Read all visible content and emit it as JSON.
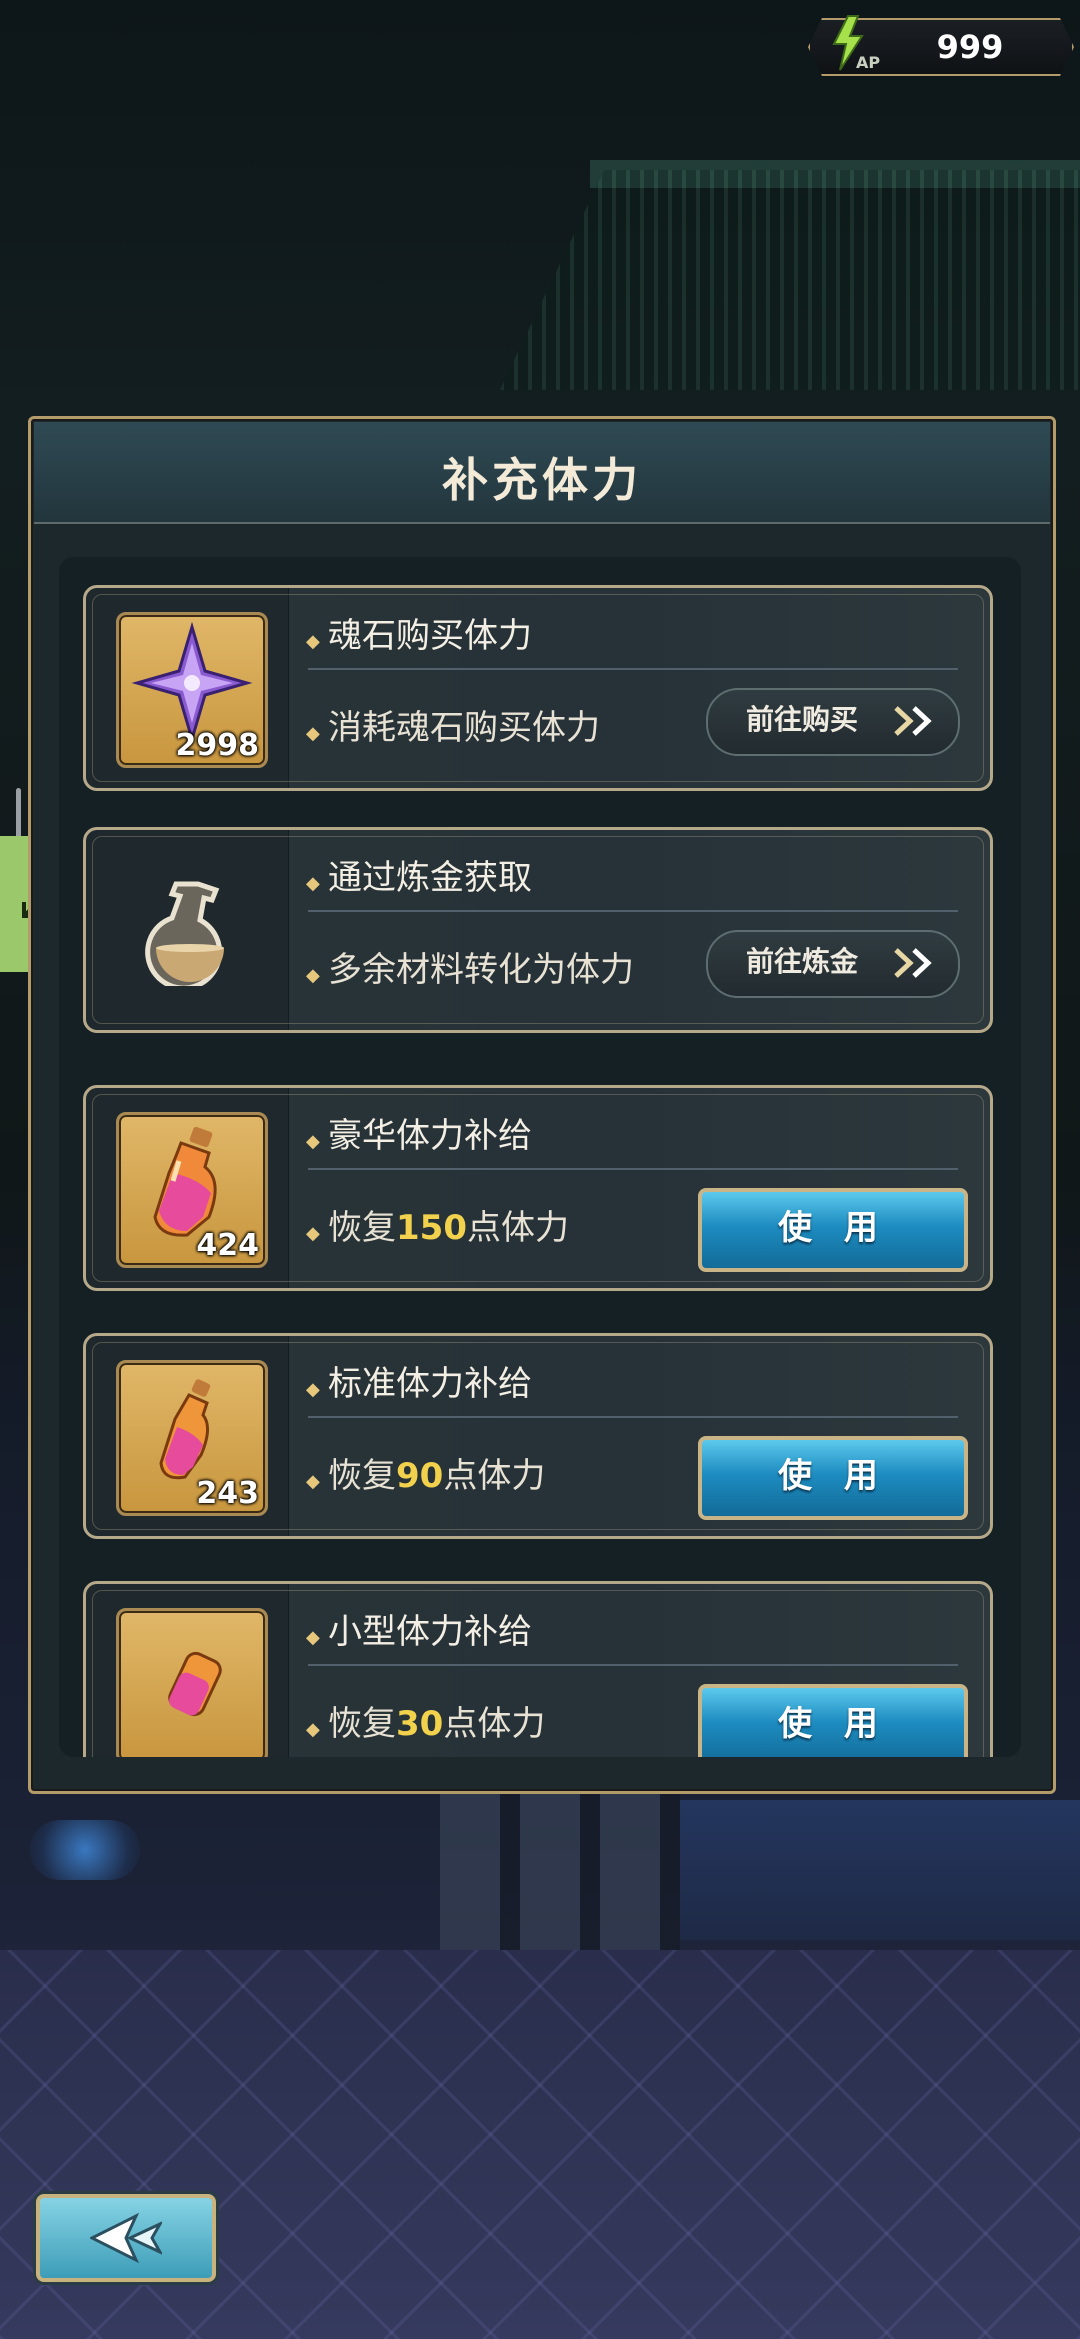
{
  "status_bar": {
    "ap_label": "AP",
    "ap_value": "999"
  },
  "panel": {
    "title": "补充体力",
    "entries": [
      {
        "type": "shop",
        "icon": "soul-stone-icon",
        "item_count": "2998",
        "title": "魂石购买体力",
        "description": "消耗魂石购买体力",
        "action_label": "前往购买"
      },
      {
        "type": "alchemy",
        "icon": "flask-icon",
        "title": "通过炼金获取",
        "description": "多余材料转化为体力",
        "action_label": "前往炼金"
      },
      {
        "type": "potion",
        "icon": "large-stamina-potion-icon",
        "item_count": "424",
        "title": "豪华体力补给",
        "desc_prefix": "恢复",
        "desc_value": "150",
        "desc_suffix": "点体力",
        "action_label": "使 用"
      },
      {
        "type": "potion",
        "icon": "medium-stamina-potion-icon",
        "item_count": "243",
        "title": "标准体力补给",
        "desc_prefix": "恢复",
        "desc_value": "90",
        "desc_suffix": "点体力",
        "action_label": "使 用"
      },
      {
        "type": "potion",
        "icon": "small-stamina-potion-icon",
        "title": "小型体力补给",
        "desc_prefix": "恢复",
        "desc_value": "30",
        "desc_suffix": "点体力",
        "action_label": "使 用"
      }
    ]
  },
  "colors": {
    "gold_border": "#b39c6a",
    "highlight_number": "#f2d24c",
    "use_button": "#1d8cc0",
    "side_tab": "#9bc86a"
  },
  "controls": {
    "back_button_icon": "back-arrow-icon",
    "side_tab_icon": "expand-icon"
  }
}
